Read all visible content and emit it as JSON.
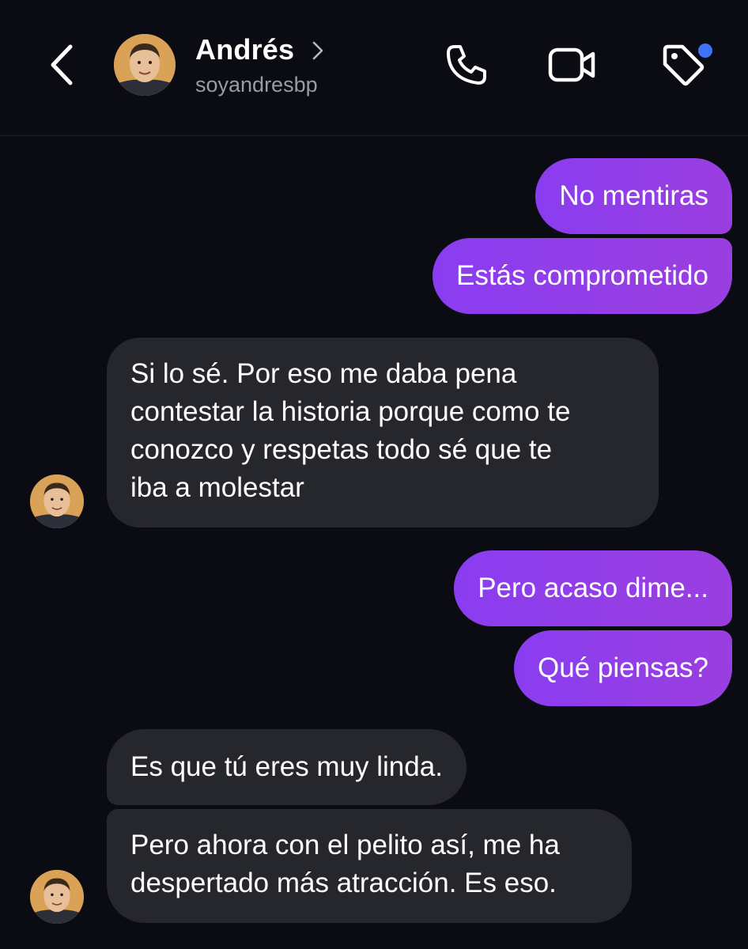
{
  "header": {
    "contact_name": "Andrés",
    "contact_handle": "soyandresbp",
    "icons": {
      "back": "chevron-left-icon",
      "profile": "chevron-right-icon",
      "call": "phone-icon",
      "video": "video-camera-icon",
      "tag": "tag-icon"
    },
    "notification_dot_color": "#3e73f5"
  },
  "colors": {
    "background": "#0b0c13",
    "outgoing_bubble": "#8a3df0",
    "incoming_bubble": "#26272d"
  },
  "messages": [
    {
      "direction": "outgoing",
      "text": "No mentiras"
    },
    {
      "direction": "outgoing",
      "text": "Estás comprometido"
    },
    {
      "direction": "incoming",
      "lines": [
        "Si lo sé. Por eso me daba pena",
        "contestar la historia porque como te",
        "conozco y respetas todo sé que te",
        "iba a molestar"
      ]
    },
    {
      "direction": "outgoing",
      "text": "Pero acaso dime..."
    },
    {
      "direction": "outgoing",
      "text": "Qué piensas?"
    },
    {
      "direction": "incoming",
      "text": "Es que tú eres muy linda."
    },
    {
      "direction": "incoming",
      "lines": [
        "Pero ahora con el pelito así, me ha",
        "despertado más atracción. Es eso."
      ]
    }
  ]
}
